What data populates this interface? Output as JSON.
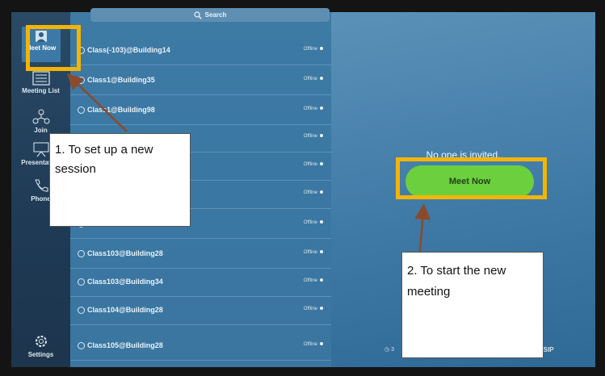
{
  "nav": {
    "meet_now": "Meet Now",
    "meeting_list": "Meeting List",
    "join": "Join",
    "present": "Presentation",
    "phone": "Phone",
    "settings": "Settings"
  },
  "search": {
    "label": "Search"
  },
  "contacts": [
    {
      "name": "Class(-103)@Building14",
      "status": "Offline"
    },
    {
      "name": "Class1@Building35",
      "status": "Offline"
    },
    {
      "name": "Class1@Building98",
      "status": "Offline"
    },
    {
      "name": "",
      "status": "Offline"
    },
    {
      "name": "",
      "status": "Offline"
    },
    {
      "name": "",
      "status": "Offline"
    },
    {
      "name": "",
      "status": "Offline"
    },
    {
      "name": "Class103@Building28",
      "status": "Offline"
    },
    {
      "name": "Class103@Building34",
      "status": "Offline"
    },
    {
      "name": "Class104@Building28",
      "status": "Offline"
    },
    {
      "name": "Class105@Building28",
      "status": "Offline"
    }
  ],
  "main": {
    "empty_message": "No one is invited.",
    "meet_now_button": "Meet Now",
    "footer_left": "3",
    "footer_right": "3/SIP"
  },
  "annotations": {
    "callout_1": "1. To set up a new session",
    "callout_2": "2. To start the new meeting"
  },
  "colors": {
    "highlight": "#f4b400",
    "meet_button": "#6bcf3e",
    "arrow": "#8b4a2b"
  }
}
